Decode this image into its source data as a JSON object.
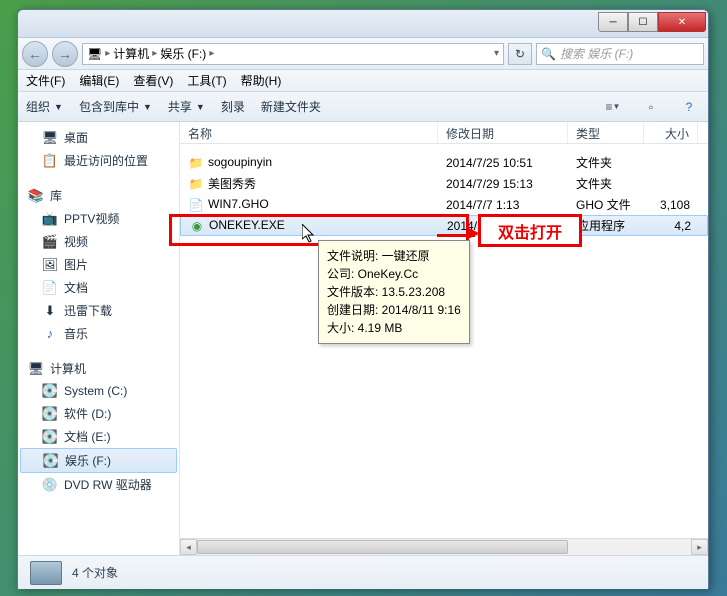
{
  "window": {
    "btn_min": "─",
    "btn_max": "☐",
    "btn_close": "✕"
  },
  "nav": {
    "back": "←",
    "forward": "→",
    "path_root": "计算机",
    "path_current": "娱乐 (F:)",
    "refresh": "↻",
    "search_placeholder": "搜索 娱乐 (F:)"
  },
  "menu": {
    "file": "文件(F)",
    "edit": "编辑(E)",
    "view": "查看(V)",
    "tools": "工具(T)",
    "help": "帮助(H)"
  },
  "toolbar": {
    "organize": "组织",
    "include": "包含到库中",
    "share": "共享",
    "burn": "刻录",
    "newfolder": "新建文件夹"
  },
  "columns": {
    "name": "名称",
    "modified": "修改日期",
    "type": "类型",
    "size": "大小"
  },
  "sidebar": {
    "desktop": "桌面",
    "recent": "最近访问的位置",
    "libraries": "库",
    "pptv": "PPTV视频",
    "videos": "视频",
    "pictures": "图片",
    "documents": "文档",
    "xunlei": "迅雷下载",
    "music": "音乐",
    "computer": "计算机",
    "system_c": "System (C:)",
    "software_d": "软件 (D:)",
    "docs_e": "文档 (E:)",
    "ent_f": "娱乐 (F:)",
    "dvdrw": "DVD RW 驱动器"
  },
  "files": [
    {
      "name": "sogoupinyin",
      "modified": "2014/7/25 10:51",
      "type": "文件夹",
      "size": ""
    },
    {
      "name": "美图秀秀",
      "modified": "2014/7/29 15:13",
      "type": "文件夹",
      "size": ""
    },
    {
      "name": "WIN7.GHO",
      "modified": "2014/7/7 1:13",
      "type": "GHO 文件",
      "size": "3,108"
    },
    {
      "name": "ONEKEY.EXE",
      "modified": "2014/10",
      "type": "应用程序",
      "size": "4,2"
    }
  ],
  "tooltip": {
    "l1": "文件说明: 一键还原",
    "l2": "公司: OneKey.Cc",
    "l3": "文件版本: 13.5.23.208",
    "l4": "创建日期: 2014/8/11 9:16",
    "l5": "大小: 4.19 MB"
  },
  "annotation": {
    "label": "双击打开"
  },
  "status": {
    "count": "4 个对象"
  }
}
